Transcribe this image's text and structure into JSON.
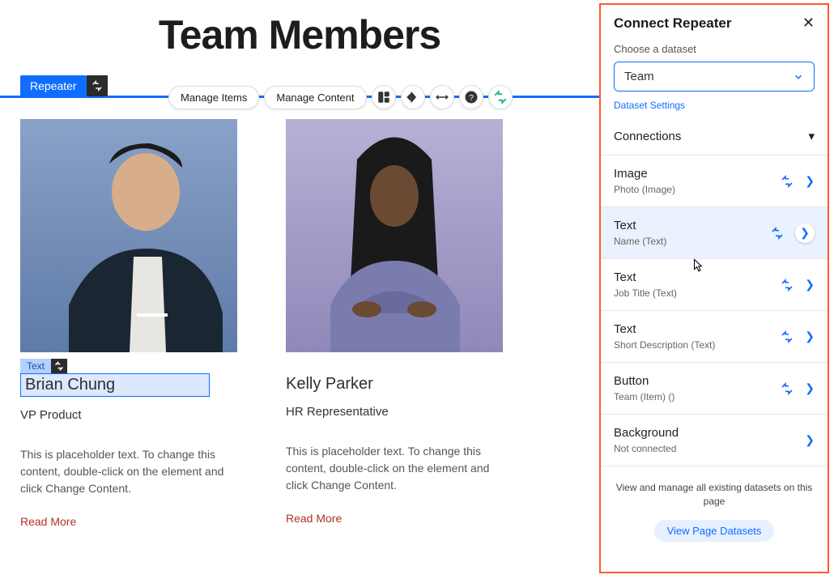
{
  "page": {
    "title": "Team Members"
  },
  "editor": {
    "repeater_label": "Repeater",
    "text_label": "Text",
    "toolbar": {
      "manage_items": "Manage Items",
      "manage_content": "Manage Content"
    }
  },
  "team": [
    {
      "name": "Brian Chung",
      "job": "VP Product",
      "desc": "This is placeholder text. To change this content, double-click on the element and click Change Content.",
      "read_more": "Read More"
    },
    {
      "name": "Kelly Parker",
      "job": "HR Representative",
      "desc": "This is placeholder text. To change this content, double-click on the element and click Change Content.",
      "read_more": "Read More"
    }
  ],
  "panel": {
    "title": "Connect Repeater",
    "choose_label": "Choose a dataset",
    "dataset_value": "Team",
    "dataset_settings": "Dataset Settings",
    "connections_label": "Connections",
    "rows": [
      {
        "title": "Image",
        "sub": "Photo (Image)",
        "bound": true
      },
      {
        "title": "Text",
        "sub": "Name (Text)",
        "bound": true,
        "hover": true
      },
      {
        "title": "Text",
        "sub": "Job Title (Text)",
        "bound": true
      },
      {
        "title": "Text",
        "sub": "Short Description (Text)",
        "bound": true
      },
      {
        "title": "Button",
        "sub": "Team (Item) ()",
        "bound": true
      },
      {
        "title": "Background",
        "sub": "Not connected",
        "bound": false
      }
    ],
    "footer_text": "View and manage all existing datasets on this page",
    "footer_button": "View Page Datasets"
  }
}
